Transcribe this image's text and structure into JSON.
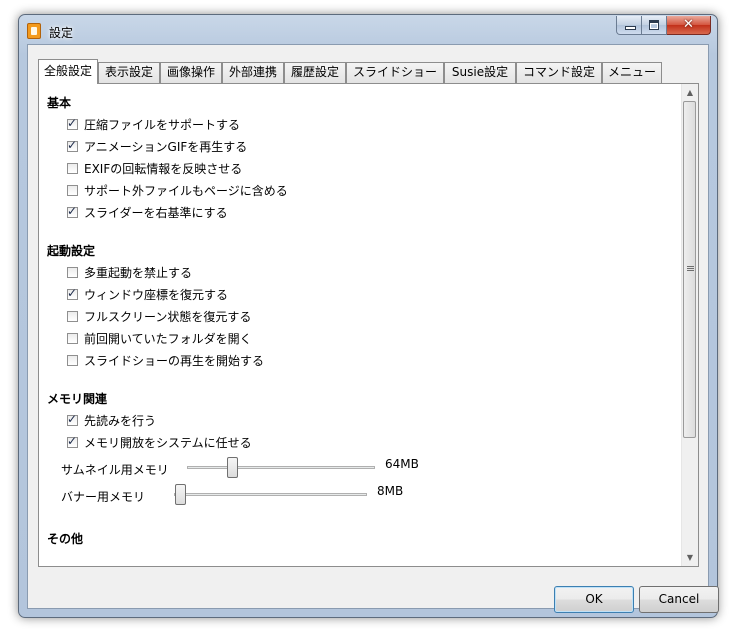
{
  "window": {
    "title": "設定"
  },
  "tabs": [
    "全般設定",
    "表示設定",
    "画像操作",
    "外部連携",
    "履歴設定",
    "スライドショー",
    "Susie設定",
    "コマンド設定",
    "メニュー"
  ],
  "sections": {
    "basic": {
      "title": "基本",
      "items": [
        {
          "label": "圧縮ファイルをサポートする",
          "checked": true
        },
        {
          "label": "アニメーションGIFを再生する",
          "checked": true
        },
        {
          "label": "EXIFの回転情報を反映させる",
          "checked": false
        },
        {
          "label": "サポート外ファイルもページに含める",
          "checked": false
        },
        {
          "label": "スライダーを右基準にする",
          "checked": true
        }
      ]
    },
    "startup": {
      "title": "起動設定",
      "items": [
        {
          "label": "多重起動を禁止する",
          "checked": false
        },
        {
          "label": "ウィンドウ座標を復元する",
          "checked": true
        },
        {
          "label": "フルスクリーン状態を復元する",
          "checked": false
        },
        {
          "label": "前回開いていたフォルダを開く",
          "checked": false
        },
        {
          "label": "スライドショーの再生を開始する",
          "checked": false
        }
      ]
    },
    "memory": {
      "title": "メモリ関連",
      "items": [
        {
          "label": "先読みを行う",
          "checked": true
        },
        {
          "label": "メモリ開放をシステムに任せる",
          "checked": true
        }
      ],
      "sliders": [
        {
          "label": "サムネイル用メモリ",
          "value": "64MB",
          "fraction": 0.22
        },
        {
          "label": "バナー用メモリ",
          "value": "8MB",
          "fraction": 0.0
        }
      ]
    },
    "other": {
      "title": "その他"
    }
  },
  "buttons": {
    "ok": "OK",
    "cancel": "Cancel"
  }
}
